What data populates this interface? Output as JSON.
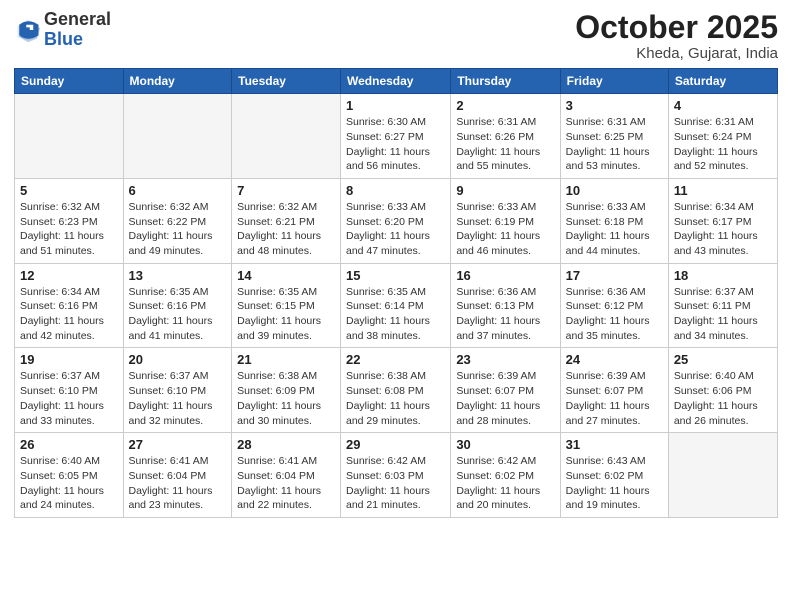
{
  "logo": {
    "general": "General",
    "blue": "Blue"
  },
  "header": {
    "month": "October 2025",
    "location": "Kheda, Gujarat, India"
  },
  "days_of_week": [
    "Sunday",
    "Monday",
    "Tuesday",
    "Wednesday",
    "Thursday",
    "Friday",
    "Saturday"
  ],
  "weeks": [
    [
      {
        "day": "",
        "info": ""
      },
      {
        "day": "",
        "info": ""
      },
      {
        "day": "",
        "info": ""
      },
      {
        "day": "1",
        "info": "Sunrise: 6:30 AM\nSunset: 6:27 PM\nDaylight: 11 hours\nand 56 minutes."
      },
      {
        "day": "2",
        "info": "Sunrise: 6:31 AM\nSunset: 6:26 PM\nDaylight: 11 hours\nand 55 minutes."
      },
      {
        "day": "3",
        "info": "Sunrise: 6:31 AM\nSunset: 6:25 PM\nDaylight: 11 hours\nand 53 minutes."
      },
      {
        "day": "4",
        "info": "Sunrise: 6:31 AM\nSunset: 6:24 PM\nDaylight: 11 hours\nand 52 minutes."
      }
    ],
    [
      {
        "day": "5",
        "info": "Sunrise: 6:32 AM\nSunset: 6:23 PM\nDaylight: 11 hours\nand 51 minutes."
      },
      {
        "day": "6",
        "info": "Sunrise: 6:32 AM\nSunset: 6:22 PM\nDaylight: 11 hours\nand 49 minutes."
      },
      {
        "day": "7",
        "info": "Sunrise: 6:32 AM\nSunset: 6:21 PM\nDaylight: 11 hours\nand 48 minutes."
      },
      {
        "day": "8",
        "info": "Sunrise: 6:33 AM\nSunset: 6:20 PM\nDaylight: 11 hours\nand 47 minutes."
      },
      {
        "day": "9",
        "info": "Sunrise: 6:33 AM\nSunset: 6:19 PM\nDaylight: 11 hours\nand 46 minutes."
      },
      {
        "day": "10",
        "info": "Sunrise: 6:33 AM\nSunset: 6:18 PM\nDaylight: 11 hours\nand 44 minutes."
      },
      {
        "day": "11",
        "info": "Sunrise: 6:34 AM\nSunset: 6:17 PM\nDaylight: 11 hours\nand 43 minutes."
      }
    ],
    [
      {
        "day": "12",
        "info": "Sunrise: 6:34 AM\nSunset: 6:16 PM\nDaylight: 11 hours\nand 42 minutes."
      },
      {
        "day": "13",
        "info": "Sunrise: 6:35 AM\nSunset: 6:16 PM\nDaylight: 11 hours\nand 41 minutes."
      },
      {
        "day": "14",
        "info": "Sunrise: 6:35 AM\nSunset: 6:15 PM\nDaylight: 11 hours\nand 39 minutes."
      },
      {
        "day": "15",
        "info": "Sunrise: 6:35 AM\nSunset: 6:14 PM\nDaylight: 11 hours\nand 38 minutes."
      },
      {
        "day": "16",
        "info": "Sunrise: 6:36 AM\nSunset: 6:13 PM\nDaylight: 11 hours\nand 37 minutes."
      },
      {
        "day": "17",
        "info": "Sunrise: 6:36 AM\nSunset: 6:12 PM\nDaylight: 11 hours\nand 35 minutes."
      },
      {
        "day": "18",
        "info": "Sunrise: 6:37 AM\nSunset: 6:11 PM\nDaylight: 11 hours\nand 34 minutes."
      }
    ],
    [
      {
        "day": "19",
        "info": "Sunrise: 6:37 AM\nSunset: 6:10 PM\nDaylight: 11 hours\nand 33 minutes."
      },
      {
        "day": "20",
        "info": "Sunrise: 6:37 AM\nSunset: 6:10 PM\nDaylight: 11 hours\nand 32 minutes."
      },
      {
        "day": "21",
        "info": "Sunrise: 6:38 AM\nSunset: 6:09 PM\nDaylight: 11 hours\nand 30 minutes."
      },
      {
        "day": "22",
        "info": "Sunrise: 6:38 AM\nSunset: 6:08 PM\nDaylight: 11 hours\nand 29 minutes."
      },
      {
        "day": "23",
        "info": "Sunrise: 6:39 AM\nSunset: 6:07 PM\nDaylight: 11 hours\nand 28 minutes."
      },
      {
        "day": "24",
        "info": "Sunrise: 6:39 AM\nSunset: 6:07 PM\nDaylight: 11 hours\nand 27 minutes."
      },
      {
        "day": "25",
        "info": "Sunrise: 6:40 AM\nSunset: 6:06 PM\nDaylight: 11 hours\nand 26 minutes."
      }
    ],
    [
      {
        "day": "26",
        "info": "Sunrise: 6:40 AM\nSunset: 6:05 PM\nDaylight: 11 hours\nand 24 minutes."
      },
      {
        "day": "27",
        "info": "Sunrise: 6:41 AM\nSunset: 6:04 PM\nDaylight: 11 hours\nand 23 minutes."
      },
      {
        "day": "28",
        "info": "Sunrise: 6:41 AM\nSunset: 6:04 PM\nDaylight: 11 hours\nand 22 minutes."
      },
      {
        "day": "29",
        "info": "Sunrise: 6:42 AM\nSunset: 6:03 PM\nDaylight: 11 hours\nand 21 minutes."
      },
      {
        "day": "30",
        "info": "Sunrise: 6:42 AM\nSunset: 6:02 PM\nDaylight: 11 hours\nand 20 minutes."
      },
      {
        "day": "31",
        "info": "Sunrise: 6:43 AM\nSunset: 6:02 PM\nDaylight: 11 hours\nand 19 minutes."
      },
      {
        "day": "",
        "info": ""
      }
    ]
  ]
}
